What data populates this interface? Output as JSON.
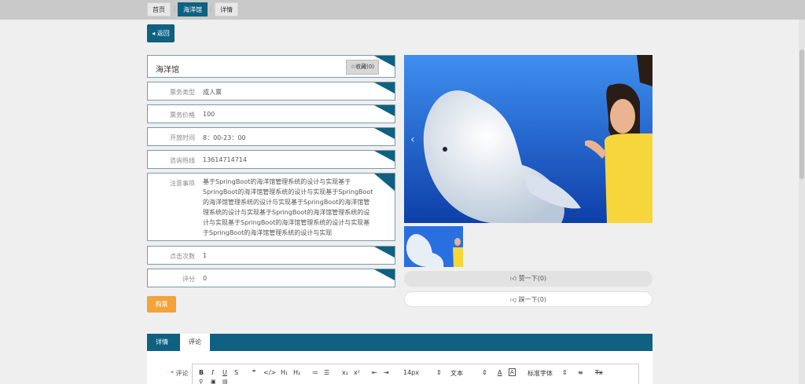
{
  "breadcrumb": {
    "home": "首页",
    "sep": "⋮",
    "current": "海洋馆",
    "detail": "详情"
  },
  "back_label": "◂ 返回",
  "detail": {
    "title": "海洋馆",
    "fav_label": "☆收藏(0)",
    "fields": [
      {
        "label": "票务类型",
        "value": "成人票"
      },
      {
        "label": "票务价格",
        "value": "100"
      },
      {
        "label": "开放时间",
        "value": "8：00-23：00"
      },
      {
        "label": "咨询热线",
        "value": "13614714714"
      }
    ],
    "notes_label": "注意事项",
    "notes_value": "基于SpringBoot的海洋馆管理系统的设计与实现基于SpringBoot的海洋馆管理系统的设计与实现基于SpringBoot的海洋馆管理系统的设计与实现基于SpringBoot的海洋馆管理系统的设计与实现基于SpringBoot的海洋馆管理系统的设计与实现基于SpringBoot的海洋馆管理系统的设计与实现基于SpringBoot的海洋馆管理系统的设计与实现",
    "clicks_label": "点击次数",
    "clicks_value": "1",
    "score_label": "评分",
    "score_value": "0"
  },
  "buy_label": "购票",
  "like_label": "赞一下(0)",
  "dislike_label": "踩一下(0)",
  "tabs": [
    "详情",
    "评论"
  ],
  "comment_label": "评论",
  "comment_required": "*",
  "toolbar": {
    "bold": "B",
    "italic": "I",
    "underline": "U",
    "strike": "S",
    "quote": "❞",
    "code": "</>",
    "h1": "H₁",
    "h2": "H₂",
    "ol": "≔",
    "ul": "☰",
    "sub": "x₂",
    "sup": "x²",
    "outdent": "⇤",
    "indent": "⇥",
    "font_size": "14px",
    "block_type": "文本",
    "font_family": "标准字体",
    "align": "≡",
    "clear": "Tx"
  },
  "colors": {
    "primary": "#0e6180",
    "accent": "#f2a33a",
    "page_bg": "#efefef"
  },
  "icons": [
    "back-arrow-icon",
    "star-icon",
    "thumb-up-icon",
    "thumb-down-icon",
    "chevron-left-icon"
  ]
}
